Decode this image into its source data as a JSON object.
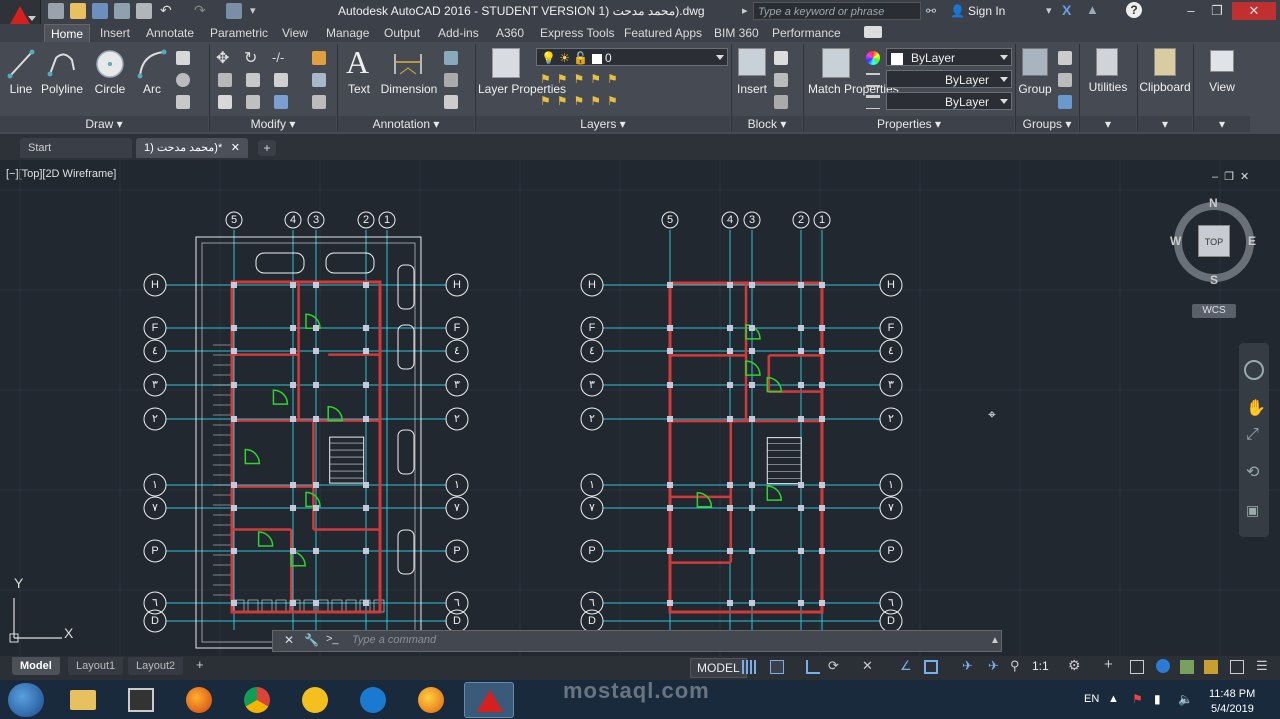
{
  "titlebar": {
    "title": "Autodesk AutoCAD 2016 - STUDENT VERSION    1) محمد مدحت).dwg",
    "search_placeholder": "Type a keyword or phrase",
    "sign_in": "Sign In"
  },
  "ribbon_tabs": [
    "Home",
    "Insert",
    "Annotate",
    "Parametric",
    "View",
    "Manage",
    "Output",
    "Add-ins",
    "A360",
    "Express Tools",
    "Featured Apps",
    "BIM 360",
    "Performance"
  ],
  "active_tab": "Home",
  "panels": {
    "draw": {
      "title": "Draw",
      "tools": [
        "Line",
        "Polyline",
        "Circle",
        "Arc"
      ]
    },
    "modify": {
      "title": "Modify"
    },
    "annotation": {
      "title": "Annotation",
      "tools": [
        "Text",
        "Dimension"
      ]
    },
    "layers": {
      "title": "Layers",
      "layer_properties": "Layer Properties",
      "current_layer": "0"
    },
    "block": {
      "title": "Block",
      "insert": "Insert"
    },
    "properties": {
      "title": "Properties",
      "match": "Match Properties",
      "color": "ByLayer",
      "linetype": "ByLayer",
      "lineweight": "ByLayer"
    },
    "groups": {
      "title": "Groups",
      "group": "Group"
    },
    "utilities": "Utilities",
    "clipboard": "Clipboard",
    "view": "View"
  },
  "file_tabs": {
    "start": "Start",
    "current": "1) محمد مدحت)*"
  },
  "viewport_label": "[−][Top][2D Wireframe]",
  "viewcube": {
    "top": "TOP",
    "n": "N",
    "s": "S",
    "e": "E",
    "w": "W",
    "wcs": "WCS"
  },
  "grid_labels_top": [
    "5",
    "4",
    "3",
    "2",
    "1"
  ],
  "grid_labels_side": [
    "H",
    "F",
    "٤",
    "٣",
    "٢",
    "١",
    "٧",
    "P",
    "٦",
    "D"
  ],
  "ucs": {
    "x": "X",
    "y": "Y"
  },
  "command_placeholder": "Type a command",
  "layout_tabs": [
    "Model",
    "Layout1",
    "Layout2"
  ],
  "status": {
    "model": "MODEL",
    "scale": "1:1"
  },
  "watermark": "mostaql.com",
  "taskbar": {
    "lang": "EN",
    "time": "11:48 PM",
    "date": "5/4/2019"
  },
  "colors": {
    "accent_red": "#d62020",
    "grid_cyan": "#2ec4d6",
    "wall_red": "#d23a3a",
    "door_green": "#2ed42e",
    "plan_white": "#e8e8e8"
  }
}
